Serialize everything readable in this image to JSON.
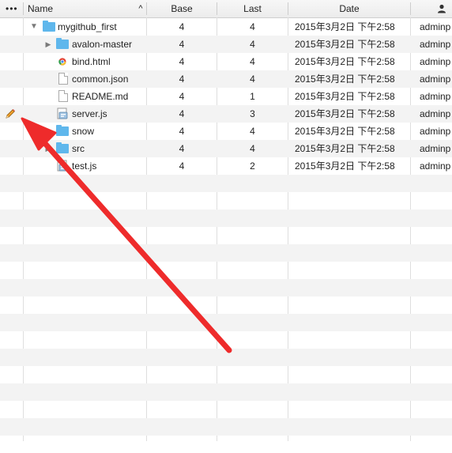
{
  "columns": {
    "menu": "•••",
    "name": "Name",
    "sort_indicator": "^",
    "base": "Base",
    "last": "Last",
    "date": "Date",
    "user_icon": "user-icon"
  },
  "rows": [
    {
      "name": "mygithub_first",
      "base": "4",
      "last": "4",
      "date": "2015年3月2日 下午2:58",
      "user": "adminp",
      "icon": "folder-icon",
      "expander": "expanded"
    },
    {
      "name": "avalon-master",
      "base": "4",
      "last": "4",
      "date": "2015年3月2日 下午2:58",
      "user": "adminp",
      "icon": "folder-icon",
      "expander": "collapsed"
    },
    {
      "name": "bind.html",
      "base": "4",
      "last": "4",
      "date": "2015年3月2日 下午2:58",
      "user": "adminp",
      "icon": "chrome-html-icon",
      "expander": "none"
    },
    {
      "name": "common.json",
      "base": "4",
      "last": "4",
      "date": "2015年3月2日 下午2:58",
      "user": "adminp",
      "icon": "document-icon",
      "expander": "none"
    },
    {
      "name": "README.md",
      "base": "4",
      "last": "1",
      "date": "2015年3月2日 下午2:58",
      "user": "adminp",
      "icon": "document-icon",
      "expander": "none"
    },
    {
      "name": "server.js",
      "base": "4",
      "last": "3",
      "date": "2015年3月2日 下午2:58",
      "user": "adminp",
      "icon": "script-icon",
      "expander": "none",
      "modified": true
    },
    {
      "name": "snow",
      "base": "4",
      "last": "4",
      "date": "2015年3月2日 下午2:58",
      "user": "adminp",
      "icon": "folder-icon",
      "expander": "collapsed"
    },
    {
      "name": "src",
      "base": "4",
      "last": "4",
      "date": "2015年3月2日 下午2:58",
      "user": "adminp",
      "icon": "folder-icon",
      "expander": "collapsed"
    },
    {
      "name": "test.js",
      "base": "4",
      "last": "2",
      "date": "2015年3月2日 下午2:58",
      "user": "adminp",
      "icon": "script-icon",
      "expander": "none"
    }
  ],
  "annotation": {
    "color": "#ee2b2b"
  },
  "colors": {
    "folder": "#5fb7ec",
    "row_alt": "#f3f3f3",
    "header": "#ececec"
  }
}
